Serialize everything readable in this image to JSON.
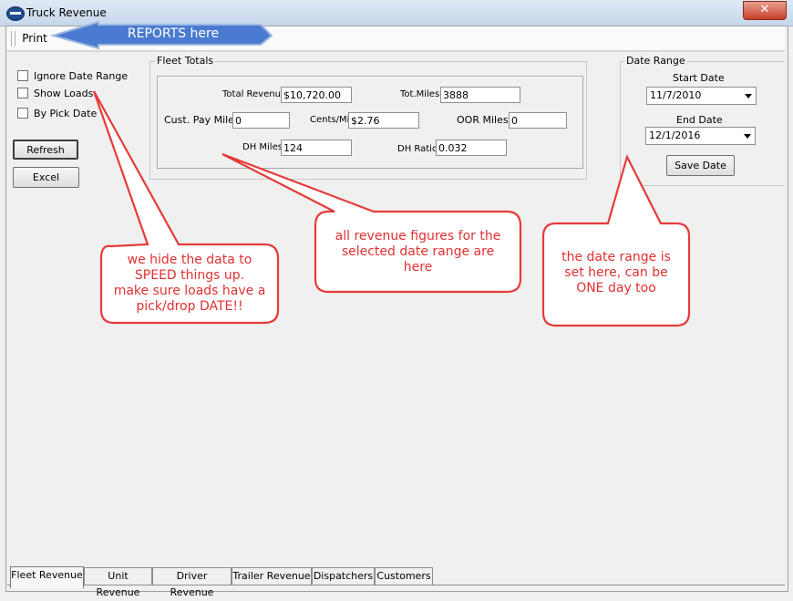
{
  "window": {
    "title": "Truck Revenue",
    "close_glyph": "✕"
  },
  "menu": {
    "print_label": "Print"
  },
  "options": {
    "ignore_date_range": "Ignore Date Range",
    "show_loads": "Show Loads",
    "by_pick_date": "By Pick Date"
  },
  "buttons": {
    "refresh": "Refresh",
    "excel": "Excel",
    "save_date": "Save Date"
  },
  "fleet_totals": {
    "group_label": "Fleet Totals",
    "total_revenue_label": "Total Revenue",
    "total_revenue_value": "$10,720.00",
    "tot_miles_label": "Tot.Miles",
    "tot_miles_value": "3888",
    "cust_pay_miles_label": "Cust. Pay Miles",
    "cust_pay_miles_value": "0",
    "cents_mi_label": "Cents/Mi",
    "cents_mi_value": "$2.76",
    "oor_miles_label": "OOR Miles",
    "oor_miles_value": "0",
    "dh_miles_label": "DH Miles",
    "dh_miles_value": "124",
    "dh_ratio_label": "DH Ratio",
    "dh_ratio_value": "0.032"
  },
  "date_range": {
    "group_label": "Date Range",
    "start_date_label": "Start Date",
    "start_date_value": "11/7/2010",
    "end_date_label": "End Date",
    "end_date_value": "12/1/2016"
  },
  "tabs": [
    "Fleet Revenue",
    "Unit Revenue",
    "Driver Revenue",
    "Trailer Revenue",
    "Dispatchers",
    "Customers"
  ],
  "annotations": {
    "reports": "REPORTS here",
    "hide_data": [
      "we hide the data to",
      "SPEED things up.",
      "make sure loads have a",
      "pick/drop DATE!!"
    ],
    "revenue": [
      "all revenue figures for the",
      "selected date range are",
      "here"
    ],
    "date_range": [
      "the date range is",
      "set here, can be",
      "ONE day too"
    ]
  },
  "colors": {
    "annotation_red": "#e03131",
    "annotation_blue": "#4a7bd0",
    "window_bg": "#f0f0f0"
  }
}
